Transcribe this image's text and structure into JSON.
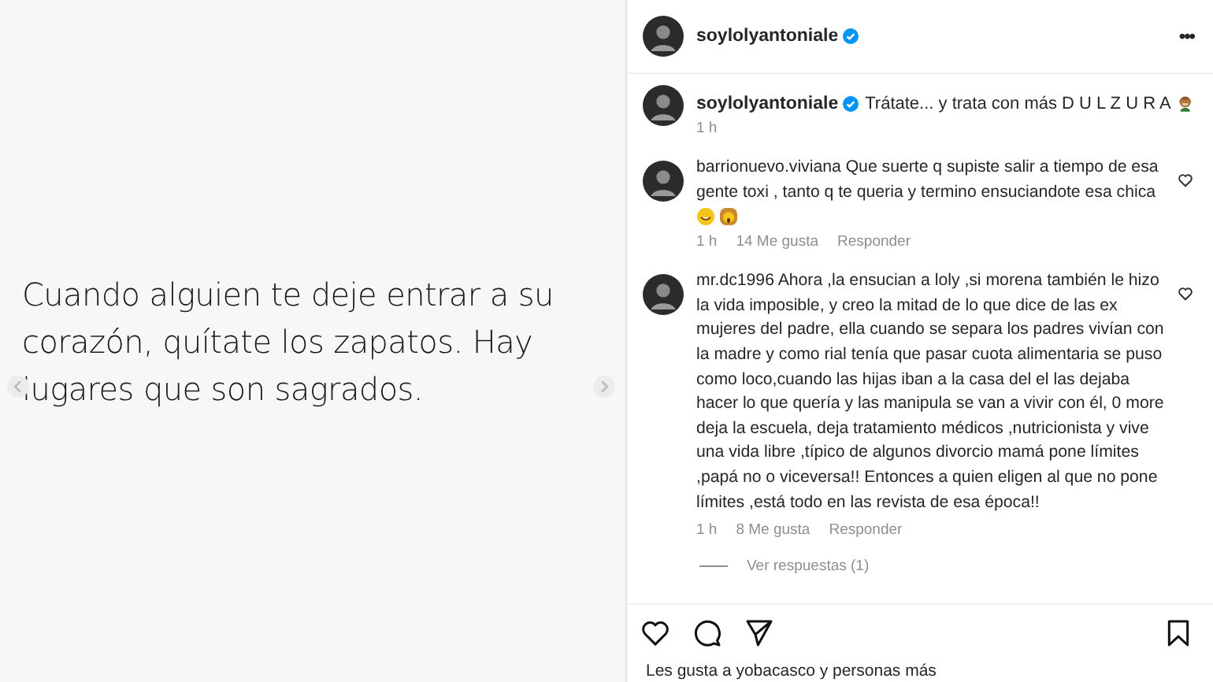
{
  "post_image": {
    "quote": "Cuando alguien te deje entrar a su corazón, quítate los zapatos. Hay lugares que son sagrados."
  },
  "header": {
    "username": "soylolyantoniale",
    "verified": true,
    "more": "•••"
  },
  "caption": {
    "username": "soylolyantoniale",
    "verified": true,
    "text": "Trátate... y trata con más D U L Z U R A",
    "time": "1 h"
  },
  "comments": [
    {
      "username": "barrionuevo.viviana",
      "text": "Que suerte q supiste salir a tiempo de esa gente toxi , tanto q te queria y termino ensuciandote esa chica",
      "emojis": true,
      "time": "1 h",
      "likes": "14 Me gusta",
      "reply": "Responder"
    },
    {
      "username": "mr.dc1996",
      "text": "Ahora ,la ensucian a loly ,si morena también le hizo la vida imposible, y creo la mitad de lo que dice de las ex mujeres del padre, ella cuando se separa los padres vivían con la madre y como rial tenía que pasar cuota alimentaria se puso como loco,cuando las hijas iban a la casa del el las dejaba hacer lo que quería y las manipula se van a vivir con él, 0 more deja la escuela, deja tratamiento médicos ,nutricionista y vive una vida libre ,típico de algunos divorcio mamá pone límites ,papá no o viceversa!! Entonces a quien eligen al que no pone límites ,está todo en las revista de esa época!!",
      "time": "1 h",
      "likes": "8 Me gusta",
      "reply": "Responder",
      "replies": "Ver respuestas (1)"
    }
  ],
  "likes_line": "Les gusta a yobacasco y personas más"
}
